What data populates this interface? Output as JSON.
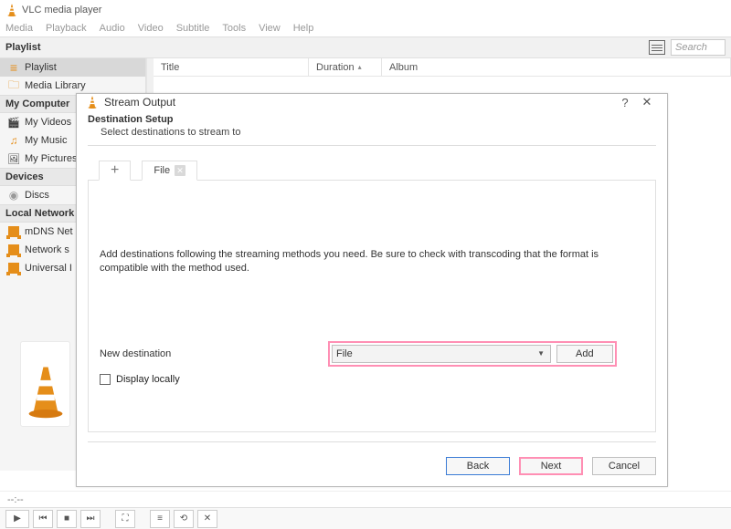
{
  "window": {
    "title": "VLC media player"
  },
  "menubar": [
    "Media",
    "Playback",
    "Audio",
    "Video",
    "Subtitle",
    "Tools",
    "View",
    "Help"
  ],
  "toolbar": {
    "search_placeholder": "Search"
  },
  "sidebar": {
    "sections": [
      {
        "heading": "Playlist",
        "items": [
          {
            "label": "Playlist",
            "icon": "lines",
            "selected": true
          },
          {
            "label": "Media Library",
            "icon": "folder"
          }
        ]
      },
      {
        "heading": "My Computer",
        "items": [
          {
            "label": "My Videos",
            "icon": "video"
          },
          {
            "label": "My Music",
            "icon": "music"
          },
          {
            "label": "My Pictures",
            "icon": "picture"
          }
        ]
      },
      {
        "heading": "Devices",
        "items": [
          {
            "label": "Discs",
            "icon": "disc"
          }
        ]
      },
      {
        "heading": "Local Network",
        "items": [
          {
            "label": "mDNS Net",
            "icon": "net"
          },
          {
            "label": "Network s",
            "icon": "net"
          },
          {
            "label": "Universal I",
            "icon": "net"
          }
        ]
      }
    ]
  },
  "columns": {
    "title": "Title",
    "duration": "Duration",
    "album": "Album"
  },
  "status": {
    "time": "--:--"
  },
  "dialog": {
    "title": "Stream Output",
    "section_title": "Destination Setup",
    "section_sub": "Select destinations to stream to",
    "file_tab": "File",
    "info_text": "Add destinations following the streaming methods you need. Be sure to check with transcoding that the format is compatible with the method used.",
    "new_dest_label": "New destination",
    "combo_value": "File",
    "add_label": "Add",
    "display_locally": "Display locally",
    "buttons": {
      "back": "Back",
      "next": "Next",
      "cancel": "Cancel"
    }
  }
}
